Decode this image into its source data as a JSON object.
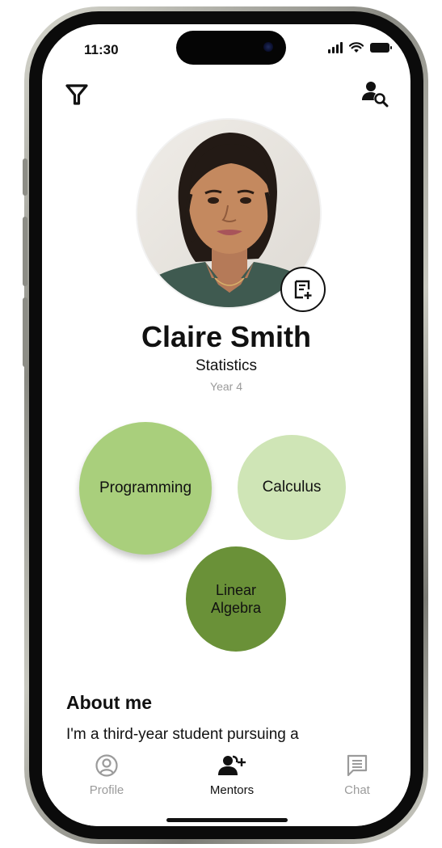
{
  "status_bar": {
    "time": "11:30"
  },
  "header": {
    "filter_icon": "filter-icon",
    "search_icon": "person-search-icon"
  },
  "profile": {
    "name": "Claire Smith",
    "major": "Statistics",
    "year": "Year 4",
    "add_note_icon": "note-add-icon"
  },
  "interests": [
    {
      "label": "Programming",
      "color": "#a9cf7c"
    },
    {
      "label": "Calculus",
      "color": "#cfe5b6"
    },
    {
      "label": "Linear Algebra",
      "color": "#6a9138"
    }
  ],
  "about": {
    "title": "About me",
    "text": "I'm a third-year student pursuing a"
  },
  "tabs": [
    {
      "label": "Profile",
      "icon": "profile-icon",
      "active": false
    },
    {
      "label": "Mentors",
      "icon": "mentors-icon",
      "active": true
    },
    {
      "label": "Chat",
      "icon": "chat-icon",
      "active": false
    }
  ]
}
